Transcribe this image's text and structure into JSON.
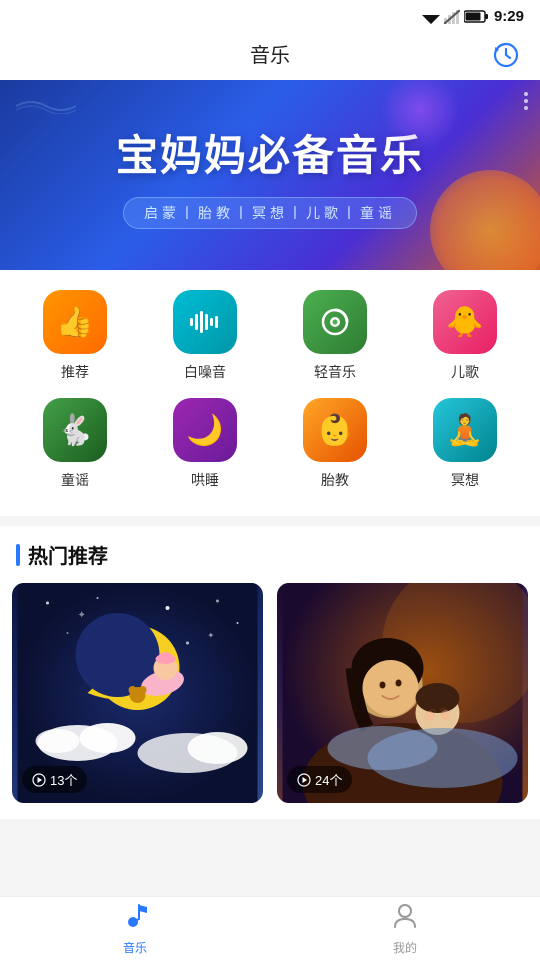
{
  "statusBar": {
    "time": "9:29"
  },
  "header": {
    "title": "音乐",
    "historyIconLabel": "history-icon"
  },
  "banner": {
    "title": "宝妈妈必备音乐",
    "subtitle": "启蒙丨胎教丨冥想丨儿歌丨童谣"
  },
  "categories": {
    "row1": [
      {
        "id": "recommend",
        "label": "推荐",
        "iconClass": "icon-orange",
        "icon": "👍"
      },
      {
        "id": "whitenoise",
        "label": "白噪音",
        "iconClass": "icon-cyan",
        "icon": "🎙"
      },
      {
        "id": "light-music",
        "label": "轻音乐",
        "iconClass": "icon-green",
        "icon": "🔄"
      },
      {
        "id": "childsong",
        "label": "儿歌",
        "iconClass": "icon-pink",
        "icon": "🐥"
      }
    ],
    "row2": [
      {
        "id": "nursery",
        "label": "童谣",
        "iconClass": "icon-green2",
        "icon": "🐇"
      },
      {
        "id": "sleep",
        "label": "哄睡",
        "iconClass": "icon-purple",
        "icon": "🌙"
      },
      {
        "id": "prenatal",
        "label": "胎教",
        "iconClass": "icon-amber",
        "icon": "👶"
      },
      {
        "id": "meditation",
        "label": "冥想",
        "iconClass": "icon-teal",
        "icon": "🧘"
      }
    ]
  },
  "hotSection": {
    "title": "热门推荐"
  },
  "cards": [
    {
      "id": "card1",
      "count": "13个",
      "theme": "moon"
    },
    {
      "id": "card2",
      "count": "24个",
      "theme": "mom"
    }
  ],
  "bottomNav": [
    {
      "id": "music",
      "label": "音乐",
      "active": true
    },
    {
      "id": "mine",
      "label": "我的",
      "active": false
    }
  ]
}
